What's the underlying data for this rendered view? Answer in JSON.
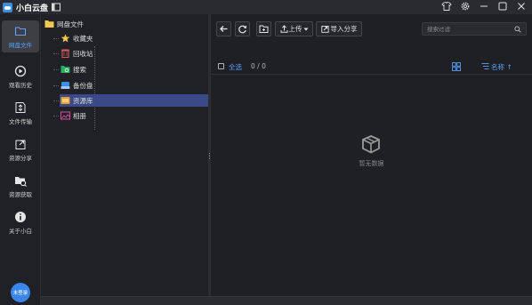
{
  "app": {
    "title": "小白云盘"
  },
  "nav": {
    "items": [
      {
        "label": "网盘文件",
        "icon": "folder-icon",
        "active": true
      },
      {
        "label": "观看历史",
        "icon": "play-history-icon",
        "active": false
      },
      {
        "label": "文件传输",
        "icon": "transfer-icon",
        "active": false
      },
      {
        "label": "资源分享",
        "icon": "share-icon",
        "active": false
      },
      {
        "label": "资源获取",
        "icon": "folder-search-icon",
        "active": false
      },
      {
        "label": "关于小白",
        "icon": "info-icon",
        "active": false
      }
    ],
    "avatar_text": "未登录"
  },
  "tree": {
    "root": "网盘文件",
    "children": [
      {
        "label": "收藏夹",
        "icon": "star-icon",
        "selected": false
      },
      {
        "label": "回收站",
        "icon": "trash-icon",
        "selected": false
      },
      {
        "label": "搜索",
        "icon": "search-folder-icon",
        "selected": false
      },
      {
        "label": "备份盘",
        "icon": "backup-drive-icon",
        "selected": false
      },
      {
        "label": "资源库",
        "icon": "library-icon",
        "selected": true
      },
      {
        "label": "相册",
        "icon": "album-icon",
        "selected": false
      }
    ]
  },
  "toolbar": {
    "upload_label": "上传",
    "import_share_label": "导入分享",
    "search_placeholder": "搜索过滤"
  },
  "list": {
    "select_all_label": "全选",
    "count_text": "0 / 0",
    "sort_label": "名称 ↑",
    "empty_text": "暂无数据"
  },
  "colors": {
    "accent": "#5aa0ff",
    "background": "#1f2024",
    "selected_row": "#3a4a86",
    "avatar": "#3a86e8"
  }
}
